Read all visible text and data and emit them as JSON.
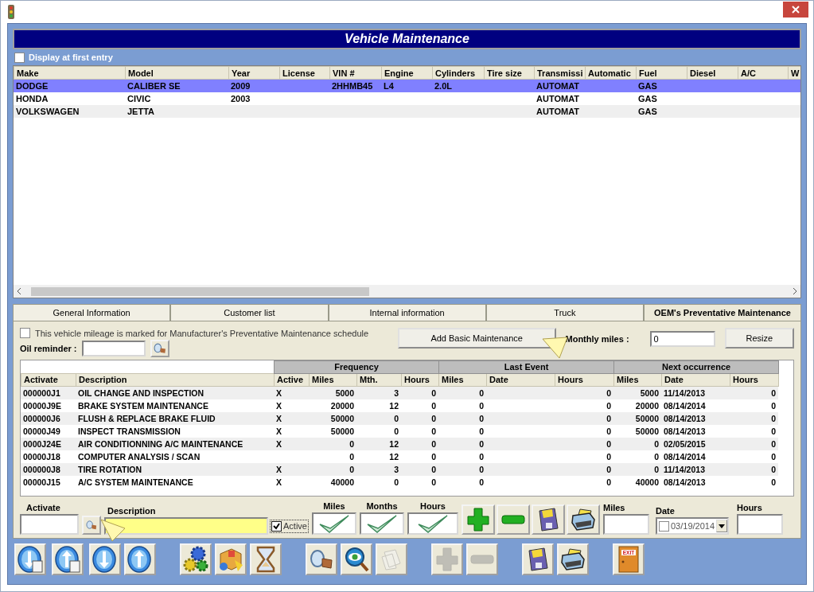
{
  "title": "Vehicle Maintenance",
  "display_at_first_entry": {
    "label": "Display at first entry",
    "checked": false
  },
  "vehicles": {
    "columns": [
      "Make",
      "Model",
      "Year",
      "License",
      "VIN #",
      "Engine",
      "Cylinders",
      "Tire size",
      "Transmissi",
      "Automatic",
      "Fuel",
      "Diesel",
      "A/C",
      "W"
    ],
    "rows": [
      {
        "make": "DODGE",
        "model": "CALIBER SE",
        "year": "2009",
        "vin": "2HHMB45",
        "engine": "L4",
        "cylinders": "2.0L",
        "transmission": "AUTOMAT",
        "fuel": "GAS",
        "selected": true
      },
      {
        "make": "HONDA",
        "model": "CIVIC",
        "year": "2003",
        "transmission": "AUTOMAT",
        "fuel": "GAS",
        "selected": false
      },
      {
        "make": "VOLKSWAGEN",
        "model": "JETTA",
        "transmission": "AUTOMAT",
        "fuel": "GAS",
        "selected": false
      }
    ]
  },
  "tabs": [
    {
      "label": "General Information",
      "selected": false
    },
    {
      "label": "Customer list",
      "selected": false
    },
    {
      "label": "Internal information",
      "selected": false
    },
    {
      "label": "Truck",
      "selected": false
    },
    {
      "label": "OEM's Preventative Maintenance",
      "selected": true
    }
  ],
  "oem": {
    "schedule_checkbox": {
      "label": "This vehicle mileage is marked for Manufacturer's Preventative Maintenance schedule",
      "checked": false
    },
    "oil_reminder_label": "Oil reminder :",
    "add_button": "Add Basic Maintenance",
    "monthly_miles_label": "Monthly miles :",
    "monthly_miles_value": "0",
    "resize_button": "Resize",
    "column_groups": [
      {
        "columns": [
          "Activate",
          "Description"
        ]
      },
      {
        "label": "Frequency",
        "columns": [
          "Active",
          "Miles",
          "Mth.",
          "Hours"
        ]
      },
      {
        "label": "Last Event",
        "columns": [
          "Miles",
          "Date",
          "Hours"
        ]
      },
      {
        "label": "Next occurrence",
        "columns": [
          "Miles",
          "Date",
          "Hours"
        ]
      }
    ],
    "rows": [
      {
        "activate": "000000J1",
        "description": "OIL CHANGE AND INSPECTION",
        "active": "X",
        "freq_miles": "5000",
        "freq_months": "3",
        "freq_hours": "0",
        "last_miles": "0",
        "last_hours": "0",
        "next_miles": "5000",
        "next_date": "11/14/2013",
        "next_hours": "0"
      },
      {
        "activate": "00000J9E",
        "description": "BRAKE SYSTEM MAINTENANCE",
        "active": "X",
        "freq_miles": "20000",
        "freq_months": "12",
        "freq_hours": "0",
        "last_miles": "0",
        "last_hours": "0",
        "next_miles": "20000",
        "next_date": "08/14/2014",
        "next_hours": "0"
      },
      {
        "activate": "000000J6",
        "description": "FLUSH & REPLACE BRAKE FLUID",
        "active": "X",
        "freq_miles": "50000",
        "freq_months": "0",
        "freq_hours": "0",
        "last_miles": "0",
        "last_hours": "0",
        "next_miles": "50000",
        "next_date": "08/14/2013",
        "next_hours": "0"
      },
      {
        "activate": "00000J49",
        "description": "INSPECT TRANSMISSION",
        "active": "X",
        "freq_miles": "50000",
        "freq_months": "0",
        "freq_hours": "0",
        "last_miles": "0",
        "last_hours": "0",
        "next_miles": "50000",
        "next_date": "08/14/2013",
        "next_hours": "0"
      },
      {
        "activate": "0000J24E",
        "description": "AIR CONDITIONNING A/C MAINTENANCE",
        "active": "X",
        "freq_miles": "0",
        "freq_months": "12",
        "freq_hours": "0",
        "last_miles": "0",
        "last_hours": "0",
        "next_miles": "0",
        "next_date": "02/05/2015",
        "next_hours": "0"
      },
      {
        "activate": "00000J18",
        "description": "COMPUTER ANALYSIS / SCAN",
        "freq_miles": "0",
        "freq_months": "12",
        "freq_hours": "0",
        "last_miles": "0",
        "last_hours": "0",
        "next_miles": "0",
        "next_date": "08/14/2014",
        "next_hours": "0"
      },
      {
        "activate": "000000J8",
        "description": "TIRE ROTATION",
        "active": "X",
        "freq_miles": "0",
        "freq_months": "3",
        "freq_hours": "0",
        "last_miles": "0",
        "last_hours": "0",
        "next_miles": "0",
        "next_date": "11/14/2013",
        "next_hours": "0"
      },
      {
        "activate": "00000J15",
        "description": "A/C SYSTEM MAINTENANCE",
        "active": "X",
        "freq_miles": "40000",
        "freq_months": "0",
        "freq_hours": "0",
        "last_miles": "0",
        "last_hours": "0",
        "next_miles": "40000",
        "next_date": "08/14/2013",
        "next_hours": "0"
      }
    ]
  },
  "entry": {
    "activate_label": "Activate",
    "description_label": "Description",
    "active": {
      "label": "Active",
      "checked": true
    },
    "miles": {
      "label": "Miles",
      "checked": true
    },
    "months": {
      "label": "Months",
      "checked": true
    },
    "hours": {
      "label": "Hours",
      "checked": true
    },
    "buttons": [
      {
        "kind": "plus",
        "disabled": false
      },
      {
        "kind": "minus",
        "disabled": false
      },
      {
        "kind": "save",
        "disabled": false
      },
      {
        "kind": "print",
        "disabled": false
      }
    ],
    "next_miles_label": "Miles",
    "date_label": "Date",
    "date": {
      "value": "03/19/2014",
      "checked": false
    },
    "next_hours_label": "Hours"
  },
  "toolbar": [
    [
      {
        "kind": "export-down",
        "disabled": false
      },
      {
        "kind": "export-up",
        "disabled": false
      }
    ],
    [
      {
        "kind": "down",
        "disabled": false
      },
      {
        "kind": "up",
        "disabled": false
      }
    ],
    [
      {
        "kind": "gears",
        "disabled": false
      },
      {
        "kind": "box",
        "disabled": false
      },
      {
        "kind": "hourglass",
        "disabled": false
      }
    ],
    [
      {
        "kind": "lookup",
        "disabled": false
      },
      {
        "kind": "view",
        "disabled": false
      },
      {
        "kind": "document",
        "disabled": true
      }
    ],
    [
      {
        "kind": "plus",
        "disabled": true
      },
      {
        "kind": "minus",
        "disabled": true
      }
    ],
    [
      {
        "kind": "save",
        "disabled": false
      },
      {
        "kind": "print",
        "disabled": false
      }
    ],
    [
      {
        "kind": "exit",
        "disabled": false,
        "label": "EXIT"
      }
    ]
  ]
}
